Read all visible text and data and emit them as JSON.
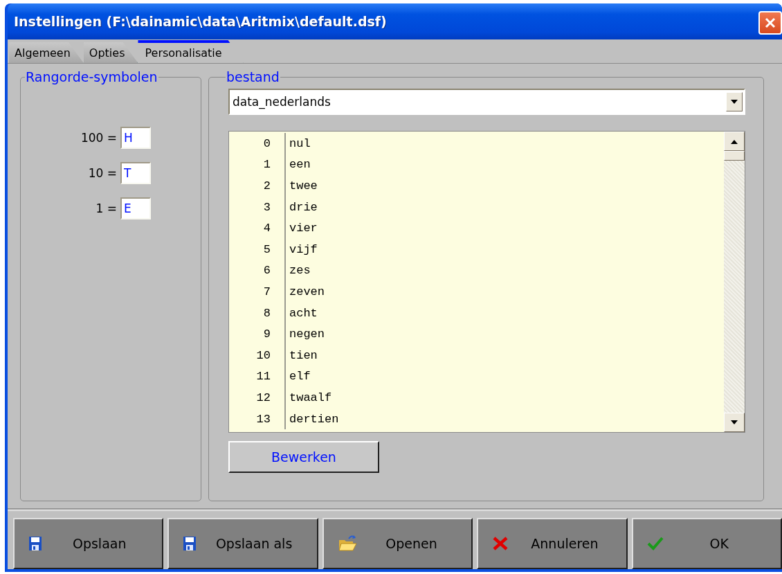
{
  "window": {
    "title": "Instellingen (F:\\dainamic\\data\\Aritmix\\default.dsf)"
  },
  "tabs": [
    {
      "label": "Algemeen",
      "selected": false
    },
    {
      "label": "Opties",
      "selected": false
    },
    {
      "label": "Personalisatie",
      "selected": true
    }
  ],
  "symbols_group": {
    "title": "Rangorde-symbolen",
    "fields": [
      {
        "label": "100 =",
        "value": "H"
      },
      {
        "label": "10 =",
        "value": "T"
      },
      {
        "label": "1 =",
        "value": "E"
      }
    ]
  },
  "file_group": {
    "title": "bestand",
    "file_select": {
      "value": "data_nederlands"
    },
    "rows": [
      {
        "number": "0",
        "word": "nul"
      },
      {
        "number": "1",
        "word": "een"
      },
      {
        "number": "2",
        "word": "twee"
      },
      {
        "number": "3",
        "word": "drie"
      },
      {
        "number": "4",
        "word": "vier"
      },
      {
        "number": "5",
        "word": "vijf"
      },
      {
        "number": "6",
        "word": "zes"
      },
      {
        "number": "7",
        "word": "zeven"
      },
      {
        "number": "8",
        "word": "acht"
      },
      {
        "number": "9",
        "word": "negen"
      },
      {
        "number": "10",
        "word": "tien"
      },
      {
        "number": "11",
        "word": "elf"
      },
      {
        "number": "12",
        "word": "twaalf"
      },
      {
        "number": "13",
        "word": "dertien"
      }
    ],
    "edit_button": "Bewerken"
  },
  "buttons": [
    {
      "label": "Opslaan",
      "kind": "save"
    },
    {
      "label": "Opslaan als",
      "kind": "save"
    },
    {
      "label": "Openen",
      "kind": "open"
    },
    {
      "label": "Annuleren",
      "kind": "cancel"
    },
    {
      "label": "OK",
      "kind": "ok"
    }
  ]
}
